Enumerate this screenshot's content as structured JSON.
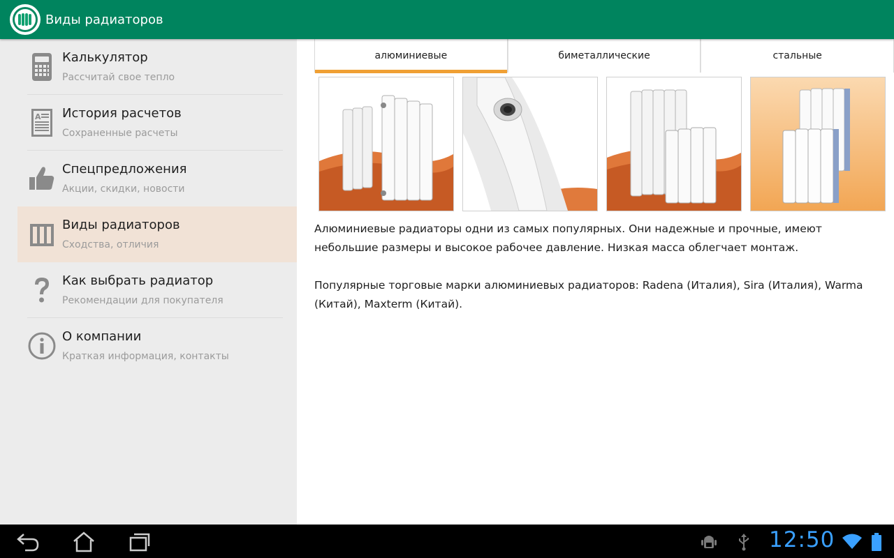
{
  "app": {
    "title": "Виды радиаторов"
  },
  "sidebar": {
    "items": [
      {
        "title": "Калькулятор",
        "subtitle": "Рассчитай свое тепло",
        "icon": "calculator-icon"
      },
      {
        "title": "История расчетов",
        "subtitle": "Сохраненные расчеты",
        "icon": "document-icon"
      },
      {
        "title": "Спецпредложения",
        "subtitle": "Акции, скидки, новости",
        "icon": "thumbs-up-icon"
      },
      {
        "title": "Виды радиаторов",
        "subtitle": "Сходства, отличия",
        "icon": "radiator-icon",
        "selected": true
      },
      {
        "title": "Как выбрать радиатор",
        "subtitle": "Рекомендации для покупателя",
        "icon": "question-icon"
      },
      {
        "title": "О компании",
        "subtitle": "Краткая информация, контакты",
        "icon": "info-icon"
      }
    ]
  },
  "tabs": [
    {
      "label": "алюминиевые",
      "selected": true
    },
    {
      "label": "биметаллические",
      "selected": false
    },
    {
      "label": "стальные",
      "selected": false
    }
  ],
  "content": {
    "paragraph1": "Алюминиевые радиаторы одни из самых популярных. Они надежные и прочные, имеют небольшие размеры и высокое рабочее давление. Низкая масса облегчает монтаж.",
    "paragraph2": "Популярные торговые марки алюминиевых радиаторов: Radena (Италия), Sira (Италия), Warma (Китай), Maxterm (Китай)."
  },
  "statusbar": {
    "time": "12:50"
  },
  "colors": {
    "actionbar": "#00845e",
    "accent_tab": "#f0a034",
    "selected_item": "#f1e2d6",
    "sidebar_bg": "#ececec",
    "clock": "#3aa0ff"
  }
}
